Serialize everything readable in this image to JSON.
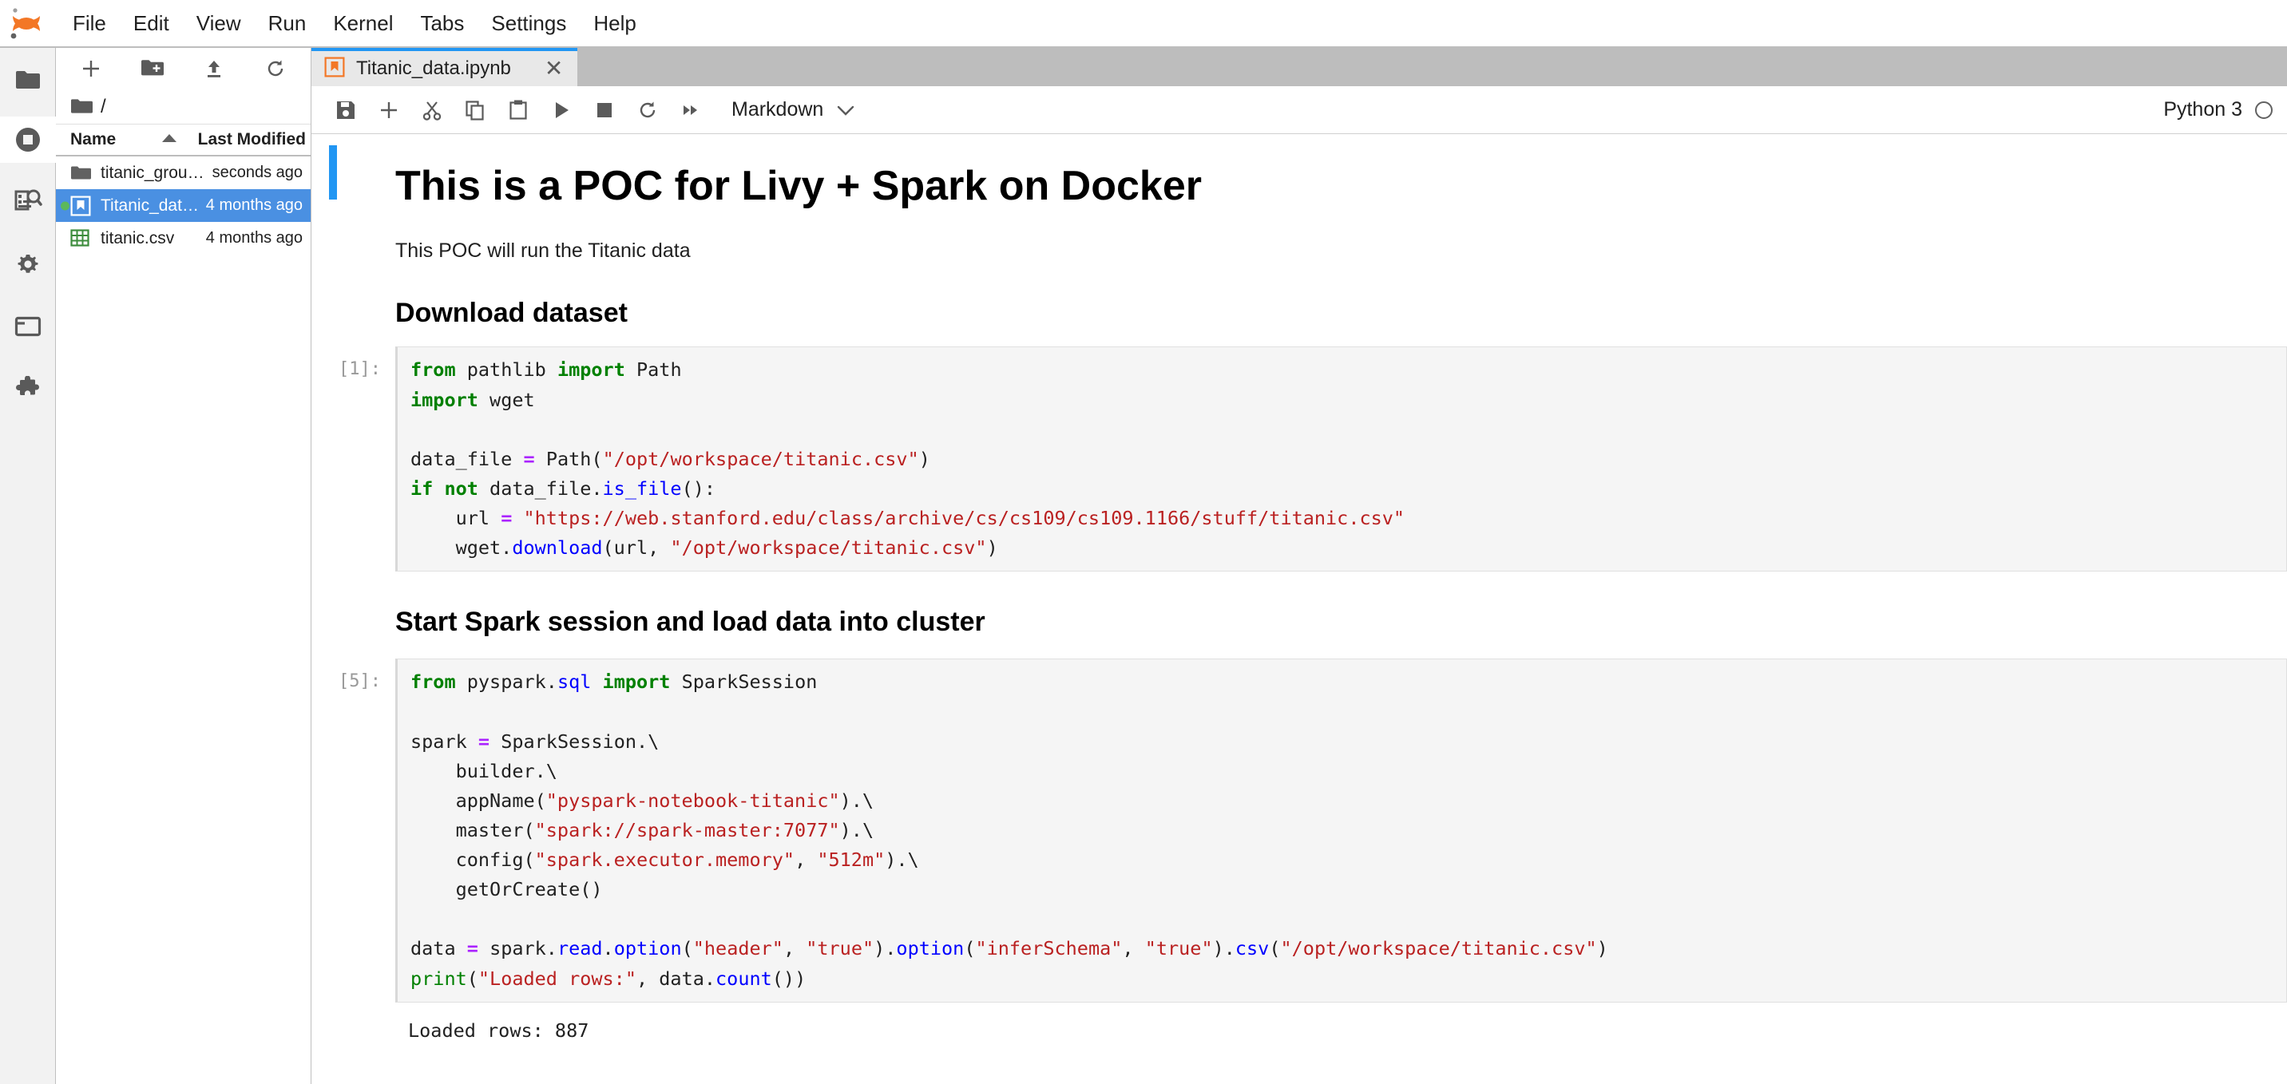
{
  "menubar": {
    "logo": "jupyter-logo",
    "items": [
      {
        "label": "File"
      },
      {
        "label": "Edit"
      },
      {
        "label": "View"
      },
      {
        "label": "Run"
      },
      {
        "label": "Kernel"
      },
      {
        "label": "Tabs"
      },
      {
        "label": "Settings"
      },
      {
        "label": "Help"
      }
    ]
  },
  "rail": {
    "items": [
      {
        "name": "file-browser-icon",
        "title": "File Browser"
      },
      {
        "name": "running-terminals-icon",
        "title": "Running Terminals and Kernels"
      },
      {
        "name": "table-of-contents-icon",
        "title": "Table of Contents"
      },
      {
        "name": "settings-gear-icon",
        "title": "Property Inspector"
      },
      {
        "name": "open-tabs-icon",
        "title": "Open Tabs"
      },
      {
        "name": "extension-manager-icon",
        "title": "Extension Manager"
      }
    ]
  },
  "filebrowser": {
    "toolbar": [
      {
        "name": "new-launcher-button",
        "glyph": "plus"
      },
      {
        "name": "new-folder-button",
        "glyph": "folder-plus"
      },
      {
        "name": "upload-button",
        "glyph": "upload"
      },
      {
        "name": "refresh-button",
        "glyph": "refresh"
      }
    ],
    "breadcrumb": {
      "root": "/"
    },
    "columns": {
      "name": "Name",
      "modified": "Last Modified"
    },
    "sort": "ascending",
    "rows": [
      {
        "name": "titanic_grouped_pass…",
        "modified": "seconds ago",
        "type": "folder",
        "selected": false,
        "dirty": false
      },
      {
        "name": "Titanic_data.ipynb",
        "modified": "4 months ago",
        "type": "notebook",
        "selected": true,
        "dirty": true
      },
      {
        "name": "titanic.csv",
        "modified": "4 months ago",
        "type": "csv",
        "selected": false,
        "dirty": false
      }
    ]
  },
  "dock": {
    "tab": {
      "title": "Titanic_data.ipynb",
      "icon": "notebook-icon",
      "close": "✕"
    }
  },
  "notebook_toolbar": {
    "buttons": [
      {
        "name": "save-button",
        "glyph": "save"
      },
      {
        "name": "insert-cell-button",
        "glyph": "plus"
      },
      {
        "name": "cut-cell-button",
        "glyph": "scissors"
      },
      {
        "name": "copy-cell-button",
        "glyph": "copy"
      },
      {
        "name": "paste-cell-button",
        "glyph": "paste"
      },
      {
        "name": "run-cell-button",
        "glyph": "play"
      },
      {
        "name": "interrupt-kernel-button",
        "glyph": "stop"
      },
      {
        "name": "restart-kernel-button",
        "glyph": "refresh"
      },
      {
        "name": "restart-and-run-all-button",
        "glyph": "fast-forward"
      }
    ],
    "cell_type": "Markdown",
    "kernel_name": "Python 3",
    "kernel_busy": false
  },
  "notebook": {
    "markdown_title": "This is a POC for Livy + Spark on Docker",
    "markdown_paragraph": "This POC will run the Titanic data",
    "section_1": "Download dataset",
    "section_2": "Start Spark session and load data into cluster",
    "cell1": {
      "prompt": "[1]:",
      "source": "from pathlib import Path\nimport wget\n\ndata_file = Path(\"/opt/workspace/titanic.csv\")\nif not data_file.is_file():\n    url = \"https://web.stanford.edu/class/archive/cs/cs109/cs109.1166/stuff/titanic.csv\"\n    wget.download(url, \"/opt/workspace/titanic.csv\")"
    },
    "cell2": {
      "prompt": "[5]:",
      "source": "from pyspark.sql import SparkSession\n\nspark = SparkSession.\\\n    builder.\\\n    appName(\"pyspark-notebook-titanic\").\\\n    master(\"spark://spark-master:7077\").\\\n    config(\"spark.executor.memory\", \"512m\").\\\n    getOrCreate()\n\ndata = spark.read.option(\"header\", \"true\").option(\"inferSchema\", \"true\").csv(\"/opt/workspace/titanic.csv\")\nprint(\"Loaded rows:\", data.count())",
      "output": "Loaded rows: 887"
    }
  },
  "colors": {
    "accent_blue": "#2196f3",
    "selection_blue": "#4a90e2",
    "jupyter_orange": "#f37726",
    "dirty_green": "#5cb85c",
    "code_bg": "#f5f5f5",
    "keyword_green": "#008000",
    "string_red": "#ba2121",
    "function_blue": "#0000ff",
    "operator_purple": "#aa22ff"
  }
}
